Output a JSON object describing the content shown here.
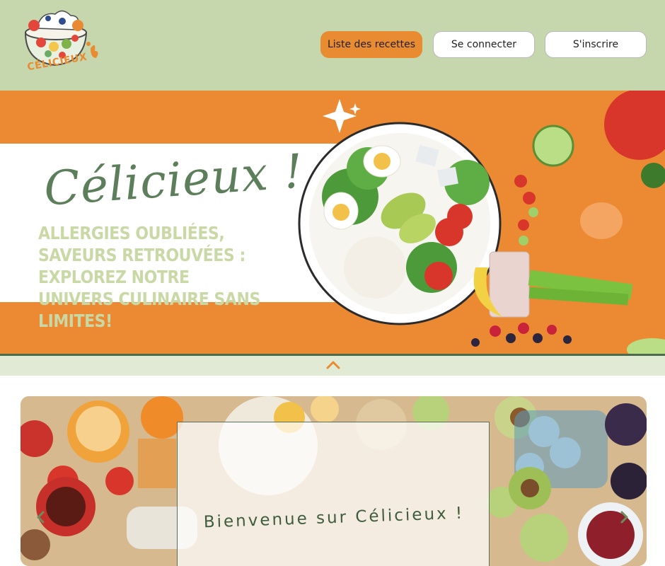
{
  "header": {
    "logo_text": "CÉLICIEUX",
    "nav": {
      "recipes": "Liste des recettes",
      "login": "Se connecter",
      "signup": "S'inscrire"
    }
  },
  "hero": {
    "title": "Célicieux !",
    "tagline": "Allergies oubliées, saveurs retrouvées : explorez notre univers culinaire sans limites!"
  },
  "carousel": {
    "welcome": "Bienvenue sur Célicieux !"
  },
  "colors": {
    "header_bg": "#c6d6ad",
    "accent_orange": "#e98b30",
    "brand_green": "#5d7e5a",
    "tagline_green": "#c8d9a6",
    "strip_bg": "#e1ead5"
  },
  "icons": {
    "collapse": "chevron-up-icon",
    "prev": "chevron-left-icon",
    "next": "chevron-right-icon"
  }
}
